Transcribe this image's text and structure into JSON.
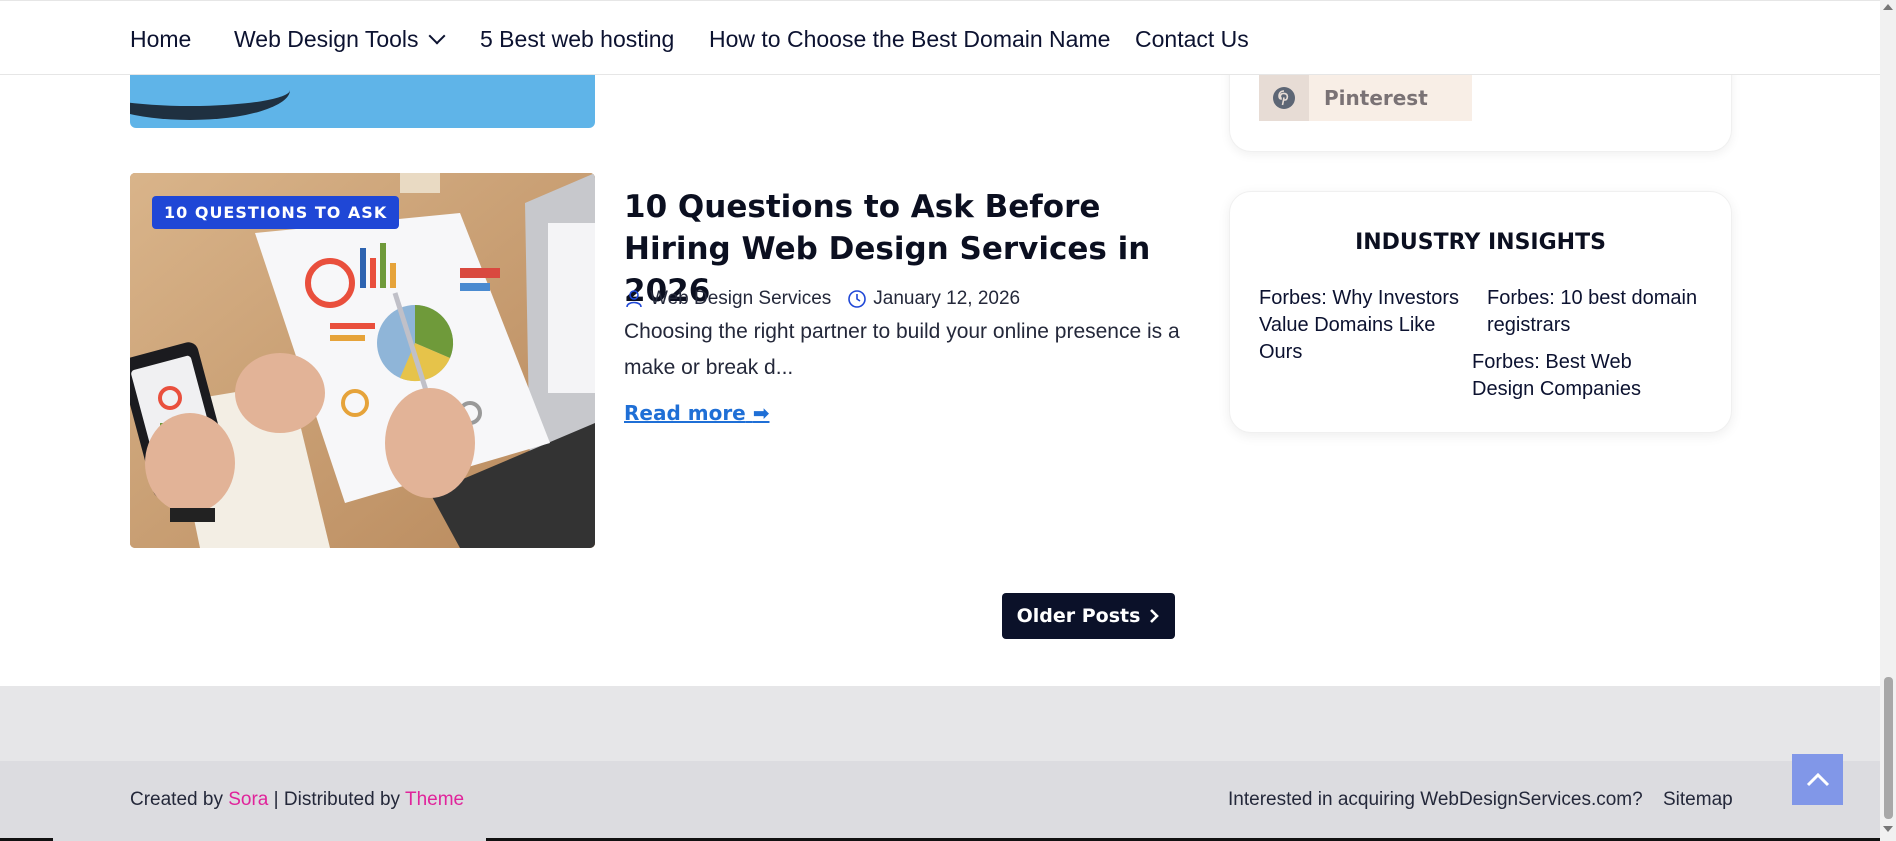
{
  "nav": {
    "items": [
      {
        "label": "Home"
      },
      {
        "label": "Web Design Tools"
      },
      {
        "label": "5 Best web hosting"
      },
      {
        "label": "How to Choose the Best Domain Name"
      },
      {
        "label": "Contact Us"
      }
    ]
  },
  "post": {
    "badge": "10 QUESTIONS TO ASK",
    "title": "10 Questions to Ask Before Hiring Web Design Services in 2026",
    "author": "Web Design Services",
    "date": "January 12, 2026",
    "excerpt": "Choosing the right partner to build your online presence is a make or break d...",
    "read_more": "Read more"
  },
  "pagination": {
    "older_label": "Older Posts"
  },
  "sidebar": {
    "social": {
      "pinterest_label": "Pinterest"
    },
    "insights": {
      "title": "INDUSTRY INSIGHTS",
      "links": [
        "Forbes: Why Investors Value Domains Like Ours",
        "Forbes: 10 best domain registrars",
        "Forbes: Best Web Design Companies"
      ]
    }
  },
  "footer": {
    "created_by": "Created by",
    "sora": "Sora",
    "distributed_by": "| Distributed by",
    "theme": "Theme",
    "acquire": "Interested in acquiring WebDesignServices.com?",
    "sitemap": "Sitemap"
  },
  "colors": {
    "accent_blue": "#1f47d6",
    "link_blue": "#1f6fd6",
    "navy": "#0b1129",
    "pink": "#e0249b",
    "to_top": "#8197e8"
  }
}
